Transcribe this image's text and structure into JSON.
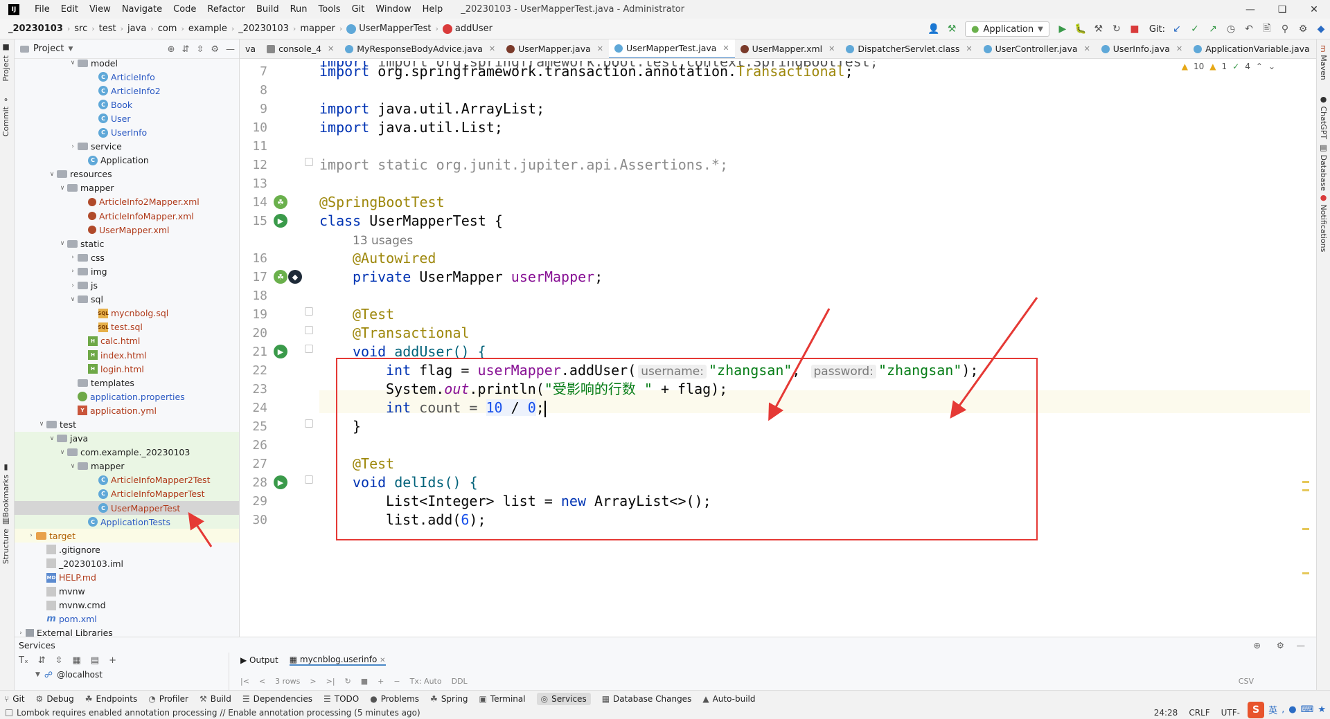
{
  "window": {
    "title": "_20230103 - UserMapperTest.java - Administrator",
    "menu": [
      "File",
      "Edit",
      "View",
      "Navigate",
      "Code",
      "Refactor",
      "Build",
      "Run",
      "Tools",
      "Git",
      "Window",
      "Help"
    ]
  },
  "breadcrumbs": [
    "_20230103",
    "src",
    "test",
    "java",
    "com",
    "example",
    "_20230103",
    "mapper",
    "UserMapperTest",
    "addUser"
  ],
  "toolbar": {
    "run_config": "Application",
    "git_label": "Git:"
  },
  "left_strip": {
    "project": "Project",
    "commit": "Commit",
    "bookmarks": "Bookmarks",
    "structure": "Structure"
  },
  "right_strip": {
    "maven": "Maven",
    "chatgpt": "ChatGPT",
    "database": "Database",
    "notifications": "Notifications"
  },
  "project_panel": {
    "title": "Project",
    "tree": [
      {
        "label": "model",
        "indent": 5,
        "arrow": "v",
        "icon": "folder",
        "color": "dark"
      },
      {
        "label": "ArticleInfo",
        "indent": 7,
        "arrow": "",
        "icon": "class",
        "color": "blue"
      },
      {
        "label": "ArticleInfo2",
        "indent": 7,
        "arrow": "",
        "icon": "class",
        "color": "blue"
      },
      {
        "label": "Book",
        "indent": 7,
        "arrow": "",
        "icon": "class",
        "color": "blue"
      },
      {
        "label": "User",
        "indent": 7,
        "arrow": "",
        "icon": "class",
        "color": "blue"
      },
      {
        "label": "UserInfo",
        "indent": 7,
        "arrow": "",
        "icon": "class",
        "color": "blue"
      },
      {
        "label": "service",
        "indent": 5,
        "arrow": ">",
        "icon": "folder",
        "color": "dark"
      },
      {
        "label": "Application",
        "indent": 6,
        "arrow": "",
        "icon": "app",
        "color": "dark"
      },
      {
        "label": "resources",
        "indent": 3,
        "arrow": "v",
        "icon": "folder",
        "color": "dark"
      },
      {
        "label": "mapper",
        "indent": 4,
        "arrow": "v",
        "icon": "folder",
        "color": "dark"
      },
      {
        "label": "ArticleInfo2Mapper.xml",
        "indent": 6,
        "arrow": "",
        "icon": "xml",
        "color": "red"
      },
      {
        "label": "ArticleInfoMapper.xml",
        "indent": 6,
        "arrow": "",
        "icon": "xml",
        "color": "red"
      },
      {
        "label": "UserMapper.xml",
        "indent": 6,
        "arrow": "",
        "icon": "xml",
        "color": "red"
      },
      {
        "label": "static",
        "indent": 4,
        "arrow": "v",
        "icon": "folder",
        "color": "dark"
      },
      {
        "label": "css",
        "indent": 5,
        "arrow": ">",
        "icon": "folder",
        "color": "dark"
      },
      {
        "label": "img",
        "indent": 5,
        "arrow": ">",
        "icon": "folder",
        "color": "dark"
      },
      {
        "label": "js",
        "indent": 5,
        "arrow": ">",
        "icon": "folder",
        "color": "dark"
      },
      {
        "label": "sql",
        "indent": 5,
        "arrow": "v",
        "icon": "folder",
        "color": "dark"
      },
      {
        "label": "mycnbolg.sql",
        "indent": 7,
        "arrow": "",
        "icon": "sql",
        "color": "red"
      },
      {
        "label": "test.sql",
        "indent": 7,
        "arrow": "",
        "icon": "sql",
        "color": "red"
      },
      {
        "label": "calc.html",
        "indent": 6,
        "arrow": "",
        "icon": "html",
        "color": "red"
      },
      {
        "label": "index.html",
        "indent": 6,
        "arrow": "",
        "icon": "html",
        "color": "red"
      },
      {
        "label": "login.html",
        "indent": 6,
        "arrow": "",
        "icon": "html",
        "color": "red"
      },
      {
        "label": "templates",
        "indent": 5,
        "arrow": "",
        "icon": "folder",
        "color": "dark"
      },
      {
        "label": "application.properties",
        "indent": 5,
        "arrow": "",
        "icon": "props",
        "color": "blue"
      },
      {
        "label": "application.yml",
        "indent": 5,
        "arrow": "",
        "icon": "yml",
        "color": "red"
      },
      {
        "label": "test",
        "indent": 2,
        "arrow": "v",
        "icon": "folder",
        "color": "dark"
      },
      {
        "label": "java",
        "indent": 3,
        "arrow": "v",
        "icon": "folder-green",
        "color": "dark",
        "bg": "green"
      },
      {
        "label": "com.example._20230103",
        "indent": 4,
        "arrow": "v",
        "icon": "folder",
        "color": "dark",
        "bg": "green"
      },
      {
        "label": "mapper",
        "indent": 5,
        "arrow": "v",
        "icon": "folder",
        "color": "dark",
        "bg": "green"
      },
      {
        "label": "ArticleInfoMapper2Test",
        "indent": 7,
        "arrow": "",
        "icon": "class",
        "color": "red",
        "bg": "green"
      },
      {
        "label": "ArticleInfoMapperTest",
        "indent": 7,
        "arrow": "",
        "icon": "class",
        "color": "red",
        "bg": "green"
      },
      {
        "label": "UserMapperTest",
        "indent": 7,
        "arrow": "",
        "icon": "class",
        "color": "red",
        "bg": "sel"
      },
      {
        "label": "ApplicationTests",
        "indent": 6,
        "arrow": "",
        "icon": "class",
        "color": "blue",
        "bg": "green"
      },
      {
        "label": "target",
        "indent": 1,
        "arrow": ">",
        "icon": "folder-orange",
        "color": "orange",
        "bg": "yellow"
      },
      {
        "label": ".gitignore",
        "indent": 2,
        "arrow": "",
        "icon": "file",
        "color": "dark"
      },
      {
        "label": "_20230103.iml",
        "indent": 2,
        "arrow": "",
        "icon": "file",
        "color": "dark"
      },
      {
        "label": "HELP.md",
        "indent": 2,
        "arrow": "",
        "icon": "md",
        "color": "red"
      },
      {
        "label": "mvnw",
        "indent": 2,
        "arrow": "",
        "icon": "file",
        "color": "dark"
      },
      {
        "label": "mvnw.cmd",
        "indent": 2,
        "arrow": "",
        "icon": "file",
        "color": "dark"
      },
      {
        "label": "pom.xml",
        "indent": 2,
        "arrow": "",
        "icon": "m",
        "color": "blue"
      },
      {
        "label": "External Libraries",
        "indent": 0,
        "arrow": ">",
        "icon": "lib",
        "color": "dark"
      }
    ]
  },
  "editor_tabs": [
    {
      "label": "va",
      "icon": "",
      "active": false,
      "closable": false
    },
    {
      "label": "console_4",
      "icon": "console",
      "active": false,
      "closable": true
    },
    {
      "label": "MyResponseBodyAdvice.java",
      "icon": "class",
      "active": false,
      "closable": true
    },
    {
      "label": "UserMapper.java",
      "icon": "bird",
      "active": false,
      "closable": true
    },
    {
      "label": "UserMapperTest.java",
      "icon": "class",
      "active": true,
      "closable": true
    },
    {
      "label": "UserMapper.xml",
      "icon": "bird",
      "active": false,
      "closable": true
    },
    {
      "label": "DispatcherServlet.class",
      "icon": "class",
      "active": false,
      "closable": true
    },
    {
      "label": "UserController.java",
      "icon": "class",
      "active": false,
      "closable": true
    },
    {
      "label": "UserInfo.java",
      "icon": "class",
      "active": false,
      "closable": true
    },
    {
      "label": "ApplicationVariable.java",
      "icon": "class",
      "active": false,
      "closable": true
    }
  ],
  "inspections": {
    "warnings": "10",
    "weak": "1",
    "typos": "4"
  },
  "code": {
    "line_numbers": [
      "7",
      "8",
      "9",
      "10",
      "11",
      "12",
      "13",
      "14",
      "15",
      "",
      "16",
      "17",
      "18",
      "19",
      "20",
      "21",
      "22",
      "23",
      "24",
      "25",
      "26",
      "27",
      "28",
      "29",
      "30"
    ],
    "partial_top": "import org.springframework.boot.test.context.SpringBootTest;",
    "line7_a": "import ",
    "line7_b": "org.springframework.transaction.annotation.",
    "line7_c": "Transactional",
    "line7_d": ";",
    "line9_a": "import ",
    "line9_b": "java.util.ArrayList;",
    "line10_a": "import ",
    "line10_b": "java.util.List;",
    "line12": "import static org.junit.jupiter.api.Assertions.*;",
    "line14": "@SpringBootTest",
    "line15_a": "class ",
    "line15_b": "UserMapperTest {",
    "usages": "13 usages",
    "line16": "@Autowired",
    "line17_a": "private ",
    "line17_b": "UserMapper ",
    "line17_c": "userMapper",
    "line17_d": ";",
    "line19": "@Test",
    "line20": "@Transactional",
    "line21_a": "void ",
    "line21_b": "addUser() {",
    "line22_a": "int ",
    "line22_b": "flag = ",
    "line22_c": "userMapper",
    "line22_d": ".addUser(",
    "line22_hint1": "username:",
    "line22_e": "\"zhangsan\"",
    "line22_f": ", ",
    "line22_hint2": "password:",
    "line22_g": "\"zhangsan\"",
    "line22_h": ");",
    "line23_a": "System.",
    "line23_b": "out",
    "line23_c": ".println(",
    "line23_d": "\"受影响的行数 \"",
    "line23_e": " + flag);",
    "line24_a": "int ",
    "line24_b": "count = ",
    "line24_c": "10",
    "line24_d": " / ",
    "line24_e": "0",
    "line24_f": ";",
    "line25": "}",
    "line27": "@Test",
    "line28_a": "void ",
    "line28_b": "delIds() {",
    "line29_a": "List<Integer> list = ",
    "line29_b": "new ",
    "line29_c": "ArrayList<>();",
    "line30_a": "list.add(",
    "line30_b": "6",
    "line30_c": ");"
  },
  "services": {
    "title": "Services",
    "tree_item": "@localhost",
    "tabs": [
      "Output",
      "mycnblog.userinfo"
    ],
    "rows_label": "3 rows",
    "tx_label": "Tx: Auto",
    "ddl_label": "DDL",
    "csv_label": "CSV"
  },
  "tool_strip": [
    "Git",
    "Debug",
    "Endpoints",
    "Profiler",
    "Build",
    "Dependencies",
    "TODO",
    "Problems",
    "Spring",
    "Terminal",
    "Services",
    "Database Changes",
    "Auto-build"
  ],
  "status": {
    "message": "Lombok requires enabled annotation processing // Enable annotation processing (5 minutes ago)",
    "position": "24:28",
    "line_sep": "CRLF",
    "encoding": "UTF-"
  },
  "ime": {
    "logo": "S",
    "lang": "英"
  },
  "colors": {
    "accent": "#4a88c7",
    "annotation_box": "#e53935"
  }
}
